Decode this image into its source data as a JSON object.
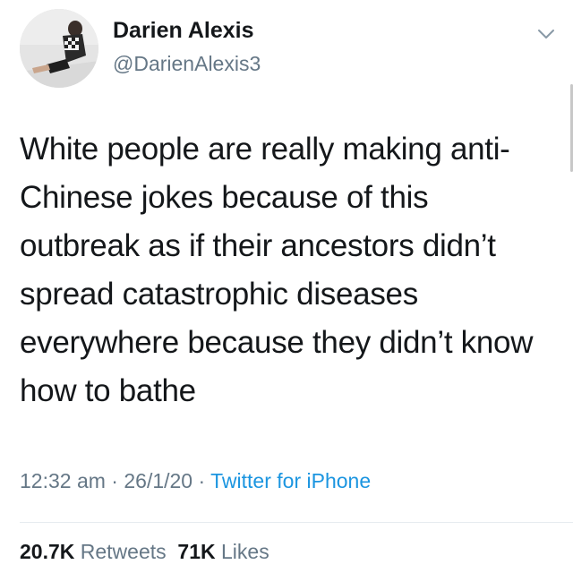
{
  "author": {
    "name": "Darien Alexis",
    "handle": "@DarienAlexis3",
    "avatar_icon": "profile-photo"
  },
  "tweet": {
    "text": "White people are really making anti-Chinese jokes because of this outbreak as if their ancestors didn’t spread catastrophic diseases everywhere because they didn’t know how to bathe",
    "time": "12:32 am",
    "date": "26/1/20",
    "source": "Twitter for iPhone",
    "separator": "·"
  },
  "stats": {
    "retweets_count": "20.7K",
    "retweets_label": "Retweets",
    "likes_count": "71K",
    "likes_label": "Likes"
  },
  "colors": {
    "text": "#14171a",
    "secondary": "#657786",
    "link": "#1b95e0",
    "divider": "#e6ecf0"
  },
  "icons": {
    "menu": "chevron-down-icon"
  }
}
